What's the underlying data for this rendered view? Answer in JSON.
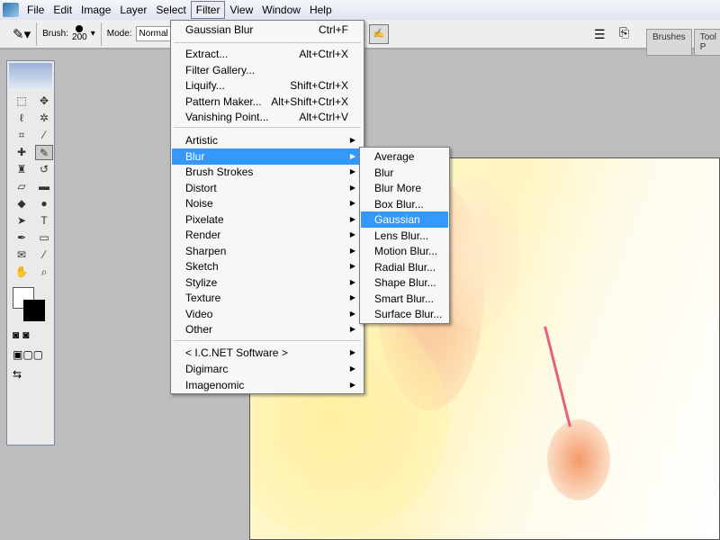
{
  "menubar": {
    "items": [
      "File",
      "Edit",
      "Image",
      "Layer",
      "Select",
      "Filter",
      "View",
      "Window",
      "Help"
    ],
    "open": "Filter"
  },
  "options": {
    "brush_label": "Brush:",
    "brush_size": "200",
    "mode_label": "Mode:",
    "mode_value": "Normal",
    "tabs": [
      "Brushes",
      "Tool P"
    ]
  },
  "filter_menu": {
    "last": {
      "label": "Gaussian Blur",
      "shortcut": "Ctrl+F"
    },
    "group1": [
      {
        "label": "Extract...",
        "shortcut": "Alt+Ctrl+X"
      },
      {
        "label": "Filter Gallery...",
        "shortcut": ""
      },
      {
        "label": "Liquify...",
        "shortcut": "Shift+Ctrl+X"
      },
      {
        "label": "Pattern Maker...",
        "shortcut": "Alt+Shift+Ctrl+X"
      },
      {
        "label": "Vanishing Point...",
        "shortcut": "Alt+Ctrl+V"
      }
    ],
    "group2": [
      "Artistic",
      "Blur",
      "Brush Strokes",
      "Distort",
      "Noise",
      "Pixelate",
      "Render",
      "Sharpen",
      "Sketch",
      "Stylize",
      "Texture",
      "Video",
      "Other"
    ],
    "group3": [
      "< I.C.NET Software >",
      "Digimarc",
      "Imagenomic"
    ],
    "highlighted": "Blur"
  },
  "blur_submenu": {
    "items": [
      "Average",
      "Blur",
      "Blur More",
      "Box Blur...",
      "Gaussian Blur...",
      "Lens Blur...",
      "Motion Blur...",
      "Radial Blur...",
      "Shape Blur...",
      "Smart Blur...",
      "Surface Blur..."
    ],
    "highlighted": "Gaussian Blur...",
    "highlight_color": "#3399ff"
  }
}
